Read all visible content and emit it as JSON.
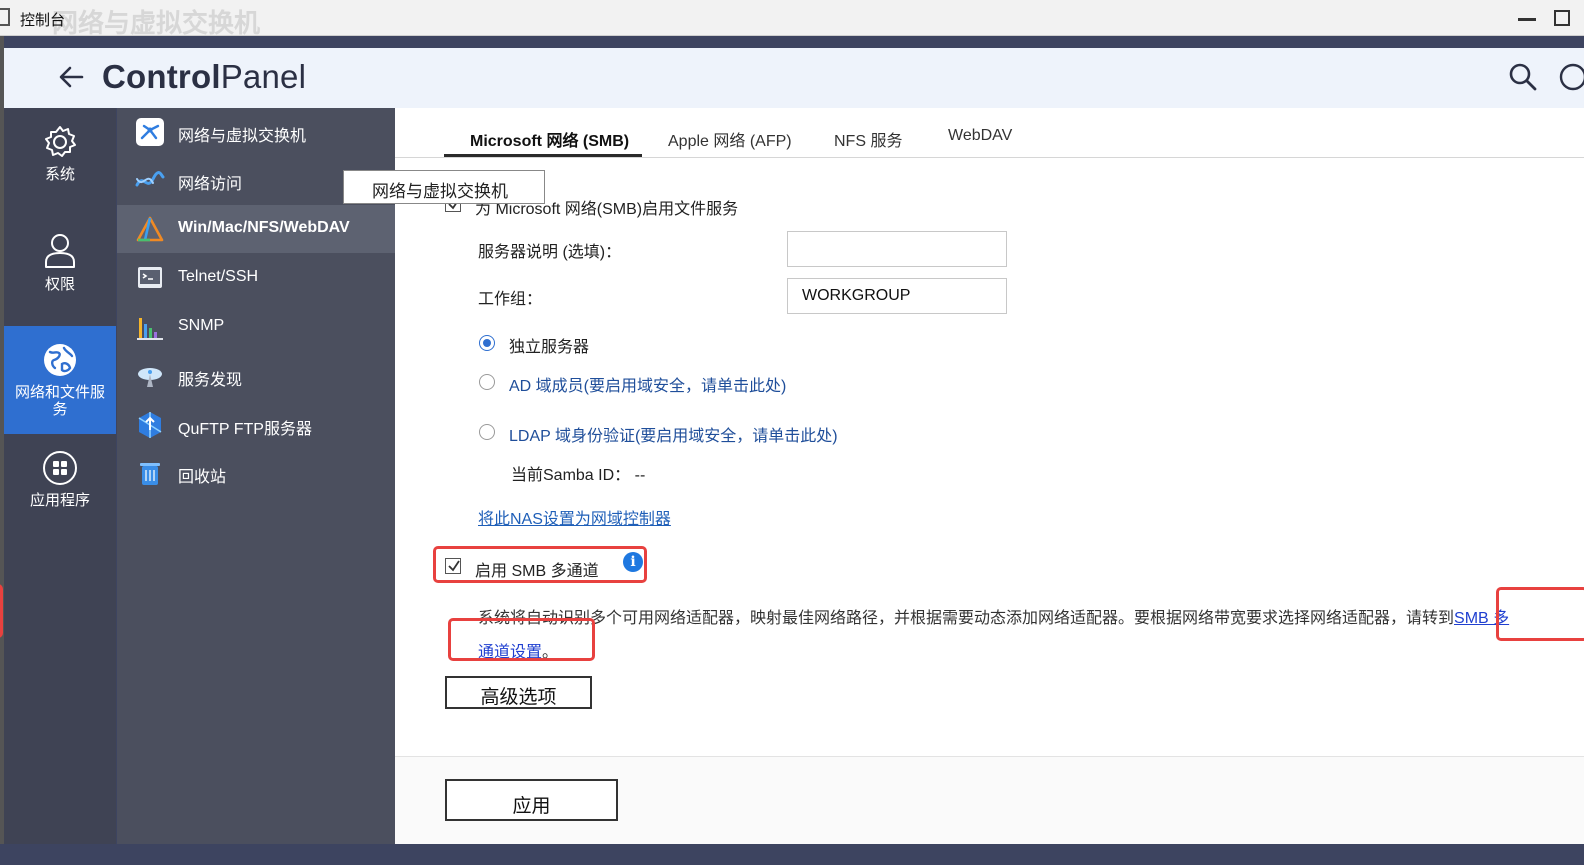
{
  "os": {
    "title": "控制台",
    "ghost_title": "网络与虚拟交换机"
  },
  "header": {
    "title_bold": "Control",
    "title_light": "Panel"
  },
  "rail": {
    "items": [
      {
        "label": "系统",
        "icon": "gear-icon"
      },
      {
        "label": "权限",
        "icon": "user-icon"
      },
      {
        "label": "网络和文件服务",
        "icon": "globe-icon",
        "active": true
      },
      {
        "label": "应用程序",
        "icon": "apps-grid-icon"
      }
    ]
  },
  "submenu": {
    "items": [
      {
        "label": "网络与虚拟交换机",
        "icon": "network-switch-icon"
      },
      {
        "label": "网络访问",
        "icon": "network-access-icon"
      },
      {
        "label": "Win/Mac/NFS/WebDAV",
        "icon": "file-protocol-icon",
        "active": true
      },
      {
        "label": "Telnet/SSH",
        "icon": "terminal-icon"
      },
      {
        "label": "SNMP",
        "icon": "bar-chart-icon"
      },
      {
        "label": "服务发现",
        "icon": "satellite-dish-icon"
      },
      {
        "label": "QuFTP FTP服务器",
        "icon": "ftp-icon"
      },
      {
        "label": "回收站",
        "icon": "trash-icon"
      }
    ]
  },
  "tooltip": "网络与虚拟交换机",
  "tabs": [
    {
      "label": "Microsoft 网络 (SMB)",
      "active": true
    },
    {
      "label": "Apple 网络 (AFP)"
    },
    {
      "label": "NFS 服务"
    },
    {
      "label": "WebDAV"
    }
  ],
  "form": {
    "enable_smb_label": "为 Microsoft 网络(SMB)启用文件服务",
    "server_desc_label": "服务器说明 (选填)：",
    "server_desc_value": "",
    "workgroup_label": "工作组：",
    "workgroup_value": "WORKGROUP",
    "radio_standalone": "独立服务器",
    "radio_ad": "AD 域成员(要启用域安全，请单击此处)",
    "radio_ldap": "LDAP 域身份验证(要启用域安全，请单击此处)",
    "samba_id_label": "当前Samba ID：",
    "samba_id_value": "--",
    "domain_controller_link": "将此NAS设置为网域控制器",
    "multichannel_label": "启用 SMB 多通道",
    "multichannel_desc": "系统将自动识别多个可用网络适配器，映射最佳网络路径，并根据需要动态添加网络适配器。要根据网络带宽要求选择网络适配器，请转到",
    "multichannel_link_part1": "SMB 多",
    "multichannel_link_part2": "通道设置",
    "multichannel_desc_end": "。",
    "advanced_button": "高级选项",
    "apply_button": "应用"
  },
  "colors": {
    "accent": "#2f6fd0",
    "highlight": "#e8413f",
    "rail_bg": "#3f4354",
    "submenu_bg": "#4b4f5e"
  }
}
